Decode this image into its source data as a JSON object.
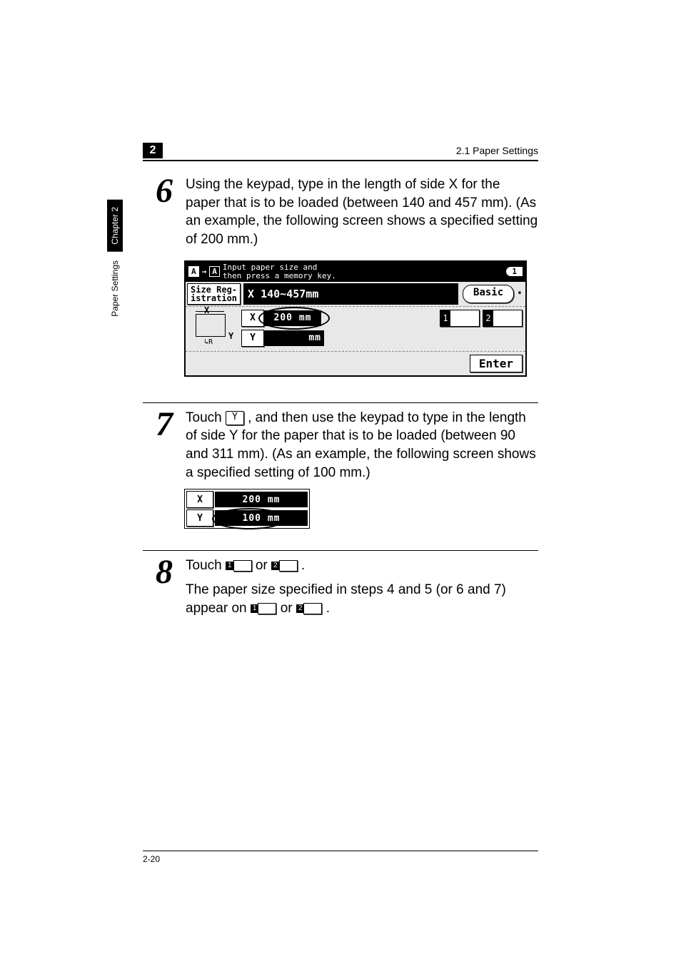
{
  "header": {
    "chapter_box": "2",
    "section_title": "2.1 Paper Settings"
  },
  "side_tabs": {
    "chapter_label": "Chapter 2",
    "tab_label": "Paper Settings"
  },
  "steps": {
    "s6": {
      "num": "6",
      "text": "Using the keypad, type in the length of side X for the paper that is to be loaded (between 140 and 457 mm). (As an example, the following screen shows a specified setting of 200 mm.)"
    },
    "s7": {
      "num": "7",
      "text_before": "Touch ",
      "btn_label": "Y",
      "text_after": " , and then use the keypad to type in the length of side Y for the paper that is to be loaded (between 90 and 311 mm). (As an example, the following screen shows a specified setting of 100 mm.)"
    },
    "s8": {
      "num": "8",
      "line1_before": "Touch ",
      "mem1": "1",
      "line1_mid": " or ",
      "mem2": "2",
      "line1_after": " .",
      "line2_before": "The paper size specified in steps 4 and 5 (or 6 and 7) appear on ",
      "line2_mid": " or ",
      "line2_after": " ."
    }
  },
  "screen": {
    "instr_line1": "Input paper size and",
    "instr_line2": "then press a memory key.",
    "one_badge": "1",
    "size_reg_l1": "Size Reg-",
    "size_reg_l2": "istration",
    "range_label": "X 140~457mm",
    "basic_label": "Basic",
    "diagram_x": "X",
    "diagram_y": "Y",
    "row_x_btn": "X",
    "row_x_val": "200 mm",
    "row_y_btn": "Y",
    "row_y_val_unit": "mm",
    "mem1": "1",
    "mem2": "2",
    "enter_label": "Enter"
  },
  "xy_fig": {
    "x_btn": "X",
    "x_val": "200 mm",
    "y_btn": "Y",
    "y_val": "100 mm"
  },
  "footer": {
    "page_num": "2-20"
  }
}
